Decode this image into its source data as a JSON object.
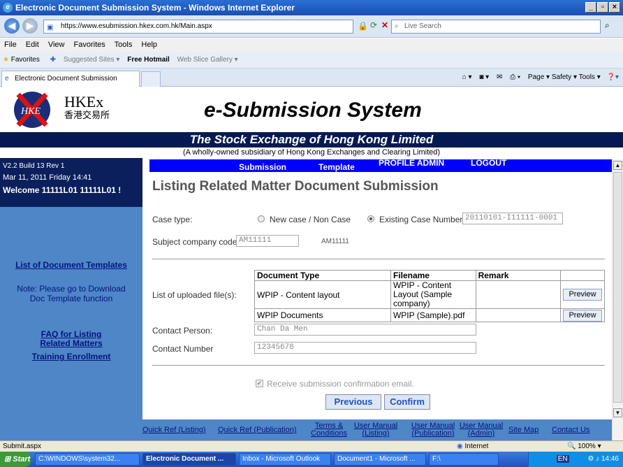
{
  "browser": {
    "window_title": "Electronic Document Submission System - Windows Internet Explorer",
    "url": "https://www.esubmission.hkex.com.hk/Main.aspx",
    "search_placeholder": "Live Search",
    "menu": [
      "File",
      "Edit",
      "View",
      "Favorites",
      "Tools",
      "Help"
    ],
    "favorites_label": "Favorites",
    "fav_items": [
      "Suggested Sites ▾",
      "Free Hotmail",
      "Web Slice Gallery ▾"
    ],
    "tab_title": "Electronic Document Submission System",
    "tab_tools": "Page ▾   Safety ▾   Tools ▾",
    "status_left": "Submit.aspx",
    "status_zone": "Internet",
    "status_zoom": "100%"
  },
  "header": {
    "logo_text": "HKEx",
    "logo_chinese": "香港交易所",
    "system_title": "e-Submission System",
    "org_name": "The Stock Exchange of Hong Kong Limited",
    "subsidiary": "(A wholly-owned subsidiary of Hong Kong Exchanges and Clearing Limited)"
  },
  "sidebar": {
    "version": "V2.2 Build 13 Rev 1",
    "date": "Mar 11, 2011 Friday 14:41",
    "welcome": "Welcome  11111L01 11111L01 !",
    "link_templates": "List of Document Templates",
    "note": "Note: Please go to Download Doc Template function",
    "link_faq": "FAQ for Listing Related Matters",
    "link_training": "Training Enrollment"
  },
  "nav": {
    "submission": "Submission",
    "template": "Template",
    "profile_admin": "PROFILE ADMIN",
    "logout": "LOGOUT"
  },
  "form": {
    "page_title": "Listing Related Matter Document Submission",
    "case_type_label": "Case type:",
    "new_case_label": "New case / Non Case",
    "existing_case_label": "Existing Case Number:",
    "existing_case_value": "20110101-I11111-0001",
    "subject_label": "Subject company code:",
    "subject_value": "AM11111",
    "subject_display": "AM11111",
    "files_label": "List of uploaded file(s):",
    "headers": [
      "Document Type",
      "Filename",
      "Remark",
      ""
    ],
    "files": [
      {
        "type": "WPIP - Content layout",
        "filename": "WPIP - Content Layout (Sample company)",
        "remark": "",
        "action": "Preview"
      },
      {
        "type": "WPIP Documents",
        "filename": "WPIP (Sample).pdf",
        "remark": "",
        "action": "Preview"
      }
    ],
    "contact_person_label": "Contact Person:",
    "contact_person_value": "Chan Da Men",
    "contact_number_label": "Contact Number",
    "contact_number_value": "12345678",
    "email_confirm": "Receive submission confirmation email.",
    "previous": "Previous",
    "confirm": "Confirm"
  },
  "footer": {
    "links": [
      "Quick Ref (Listing)",
      "Quick Ref (Publication)",
      "Terms & Conditions",
      "User Manual (Listing)",
      "User Manual (Publication)",
      "User Manual (Admin)",
      "Site Map",
      "Contact Us"
    ]
  },
  "taskbar": {
    "start": "Start",
    "items": [
      "C:\\WINDOWS\\system32...",
      "Electronic Document ...",
      "Inbox - Microsoft Outlook",
      "Document1 - Microsoft ...",
      "F:\\"
    ],
    "lang": "EN",
    "clock": "14:46"
  },
  "colors": {
    "navy": "#061a52",
    "sidebar": "#4e86c8",
    "nav_blue": "#0000ff",
    "link": "#06157a"
  }
}
